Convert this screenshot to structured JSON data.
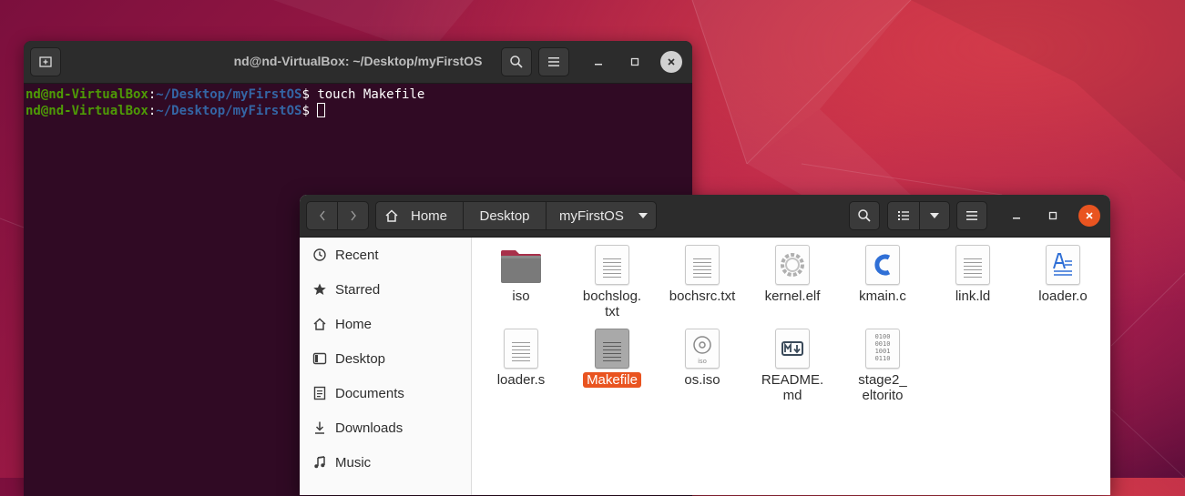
{
  "terminal": {
    "title": "nd@nd-VirtualBox: ~/Desktop/myFirstOS",
    "lines": [
      {
        "user": "nd@nd-VirtualBox",
        "path": "~/Desktop/myFirstOS",
        "prompt_end": "$",
        "command": " touch Makefile"
      },
      {
        "user": "nd@nd-VirtualBox",
        "path": "~/Desktop/myFirstOS",
        "prompt_end": "$",
        "command": " "
      }
    ]
  },
  "files": {
    "breadcrumbs": [
      "Home",
      "Desktop",
      "myFirstOS"
    ],
    "sidebar": [
      {
        "label": "Recent",
        "icon": "clock-icon"
      },
      {
        "label": "Starred",
        "icon": "star-icon"
      },
      {
        "label": "Home",
        "icon": "home-icon"
      },
      {
        "label": "Desktop",
        "icon": "desktop-icon"
      },
      {
        "label": "Documents",
        "icon": "document-icon"
      },
      {
        "label": "Downloads",
        "icon": "download-icon"
      },
      {
        "label": "Music",
        "icon": "music-icon"
      }
    ],
    "items": [
      {
        "name": "iso",
        "type": "folder"
      },
      {
        "name": "bochslog.\ntxt",
        "type": "text"
      },
      {
        "name": "bochsrc.txt",
        "type": "text"
      },
      {
        "name": "kernel.elf",
        "type": "executable"
      },
      {
        "name": "kmain.c",
        "type": "c-source"
      },
      {
        "name": "link.ld",
        "type": "text"
      },
      {
        "name": "loader.o",
        "type": "object"
      },
      {
        "name": "loader.s",
        "type": "text"
      },
      {
        "name": "Makefile",
        "type": "text",
        "selected": true
      },
      {
        "name": "os.iso",
        "type": "disc-image"
      },
      {
        "name": "README.\nmd",
        "type": "markdown"
      },
      {
        "name": "stage2_\neltorito",
        "type": "binary"
      }
    ]
  },
  "colors": {
    "accent": "#e95420",
    "terminal_bg": "#300a24",
    "prompt_user": "#4e9a06",
    "prompt_path": "#3465a4"
  }
}
